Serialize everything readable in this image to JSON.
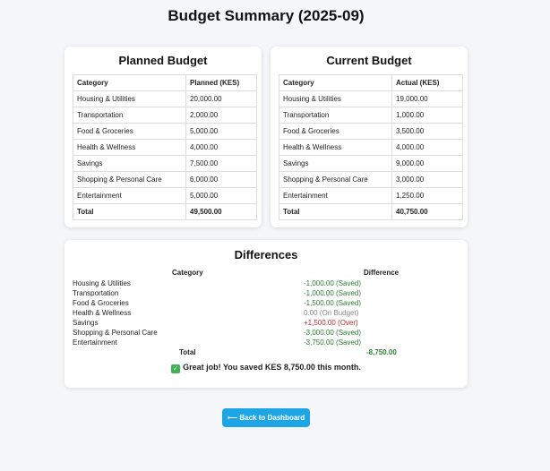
{
  "page_title": "Budget Summary (2025-09)",
  "planned": {
    "title": "Planned Budget",
    "col_category": "Category",
    "col_amount": "Planned (KES)",
    "rows": [
      {
        "category": "Housing & Utilities",
        "amount": "20,000.00"
      },
      {
        "category": "Transportation",
        "amount": "2,000.00"
      },
      {
        "category": "Food & Groceries",
        "amount": "5,000.00"
      },
      {
        "category": "Health & Wellness",
        "amount": "4,000.00"
      },
      {
        "category": "Savings",
        "amount": "7,500.00"
      },
      {
        "category": "Shopping & Personal Care",
        "amount": "6,000.00"
      },
      {
        "category": "Entertainment",
        "amount": "5,000.00"
      }
    ],
    "total_label": "Total",
    "total_amount": "49,500.00"
  },
  "current": {
    "title": "Current Budget",
    "col_category": "Category",
    "col_amount": "Actual (KES)",
    "rows": [
      {
        "category": "Housing & Utilities",
        "amount": "19,000.00"
      },
      {
        "category": "Transportation",
        "amount": "1,000.00"
      },
      {
        "category": "Food & Groceries",
        "amount": "3,500.00"
      },
      {
        "category": "Health & Wellness",
        "amount": "4,000.00"
      },
      {
        "category": "Savings",
        "amount": "9,000.00"
      },
      {
        "category": "Shopping & Personal Care",
        "amount": "3,000.00"
      },
      {
        "category": "Entertainment",
        "amount": "1,250.00"
      }
    ],
    "total_label": "Total",
    "total_amount": "40,750.00"
  },
  "differences": {
    "title": "Differences",
    "col_category": "Category",
    "col_difference": "Difference",
    "rows": [
      {
        "category": "Housing & Utilities",
        "difference": "-1,000.00 (Saved)",
        "status": "saved"
      },
      {
        "category": "Transportation",
        "difference": "-1,000.00 (Saved)",
        "status": "saved"
      },
      {
        "category": "Food & Groceries",
        "difference": "-1,500.00 (Saved)",
        "status": "saved"
      },
      {
        "category": "Health & Wellness",
        "difference": "0.00 (On Budget)",
        "status": "onbudget"
      },
      {
        "category": "Savings",
        "difference": "+1,500.00 (Over)",
        "status": "over"
      },
      {
        "category": "Shopping & Personal Care",
        "difference": "-3,000.00 (Saved)",
        "status": "saved"
      },
      {
        "category": "Entertainment",
        "difference": "-3,750.00 (Saved)",
        "status": "saved"
      }
    ],
    "total_label": "Total",
    "total_value": "-8,750.00",
    "message": "Great job! You saved KES 8,750.00 this month.",
    "message_icon": "check-mark-icon"
  },
  "colors": {
    "saved": "#2e7d32",
    "over": "#c62828",
    "on_budget": "#888888",
    "button": "#1ea5e6"
  },
  "back_button": {
    "label": "⟵ Back to Dashboard",
    "icon": "arrow-left-icon"
  }
}
